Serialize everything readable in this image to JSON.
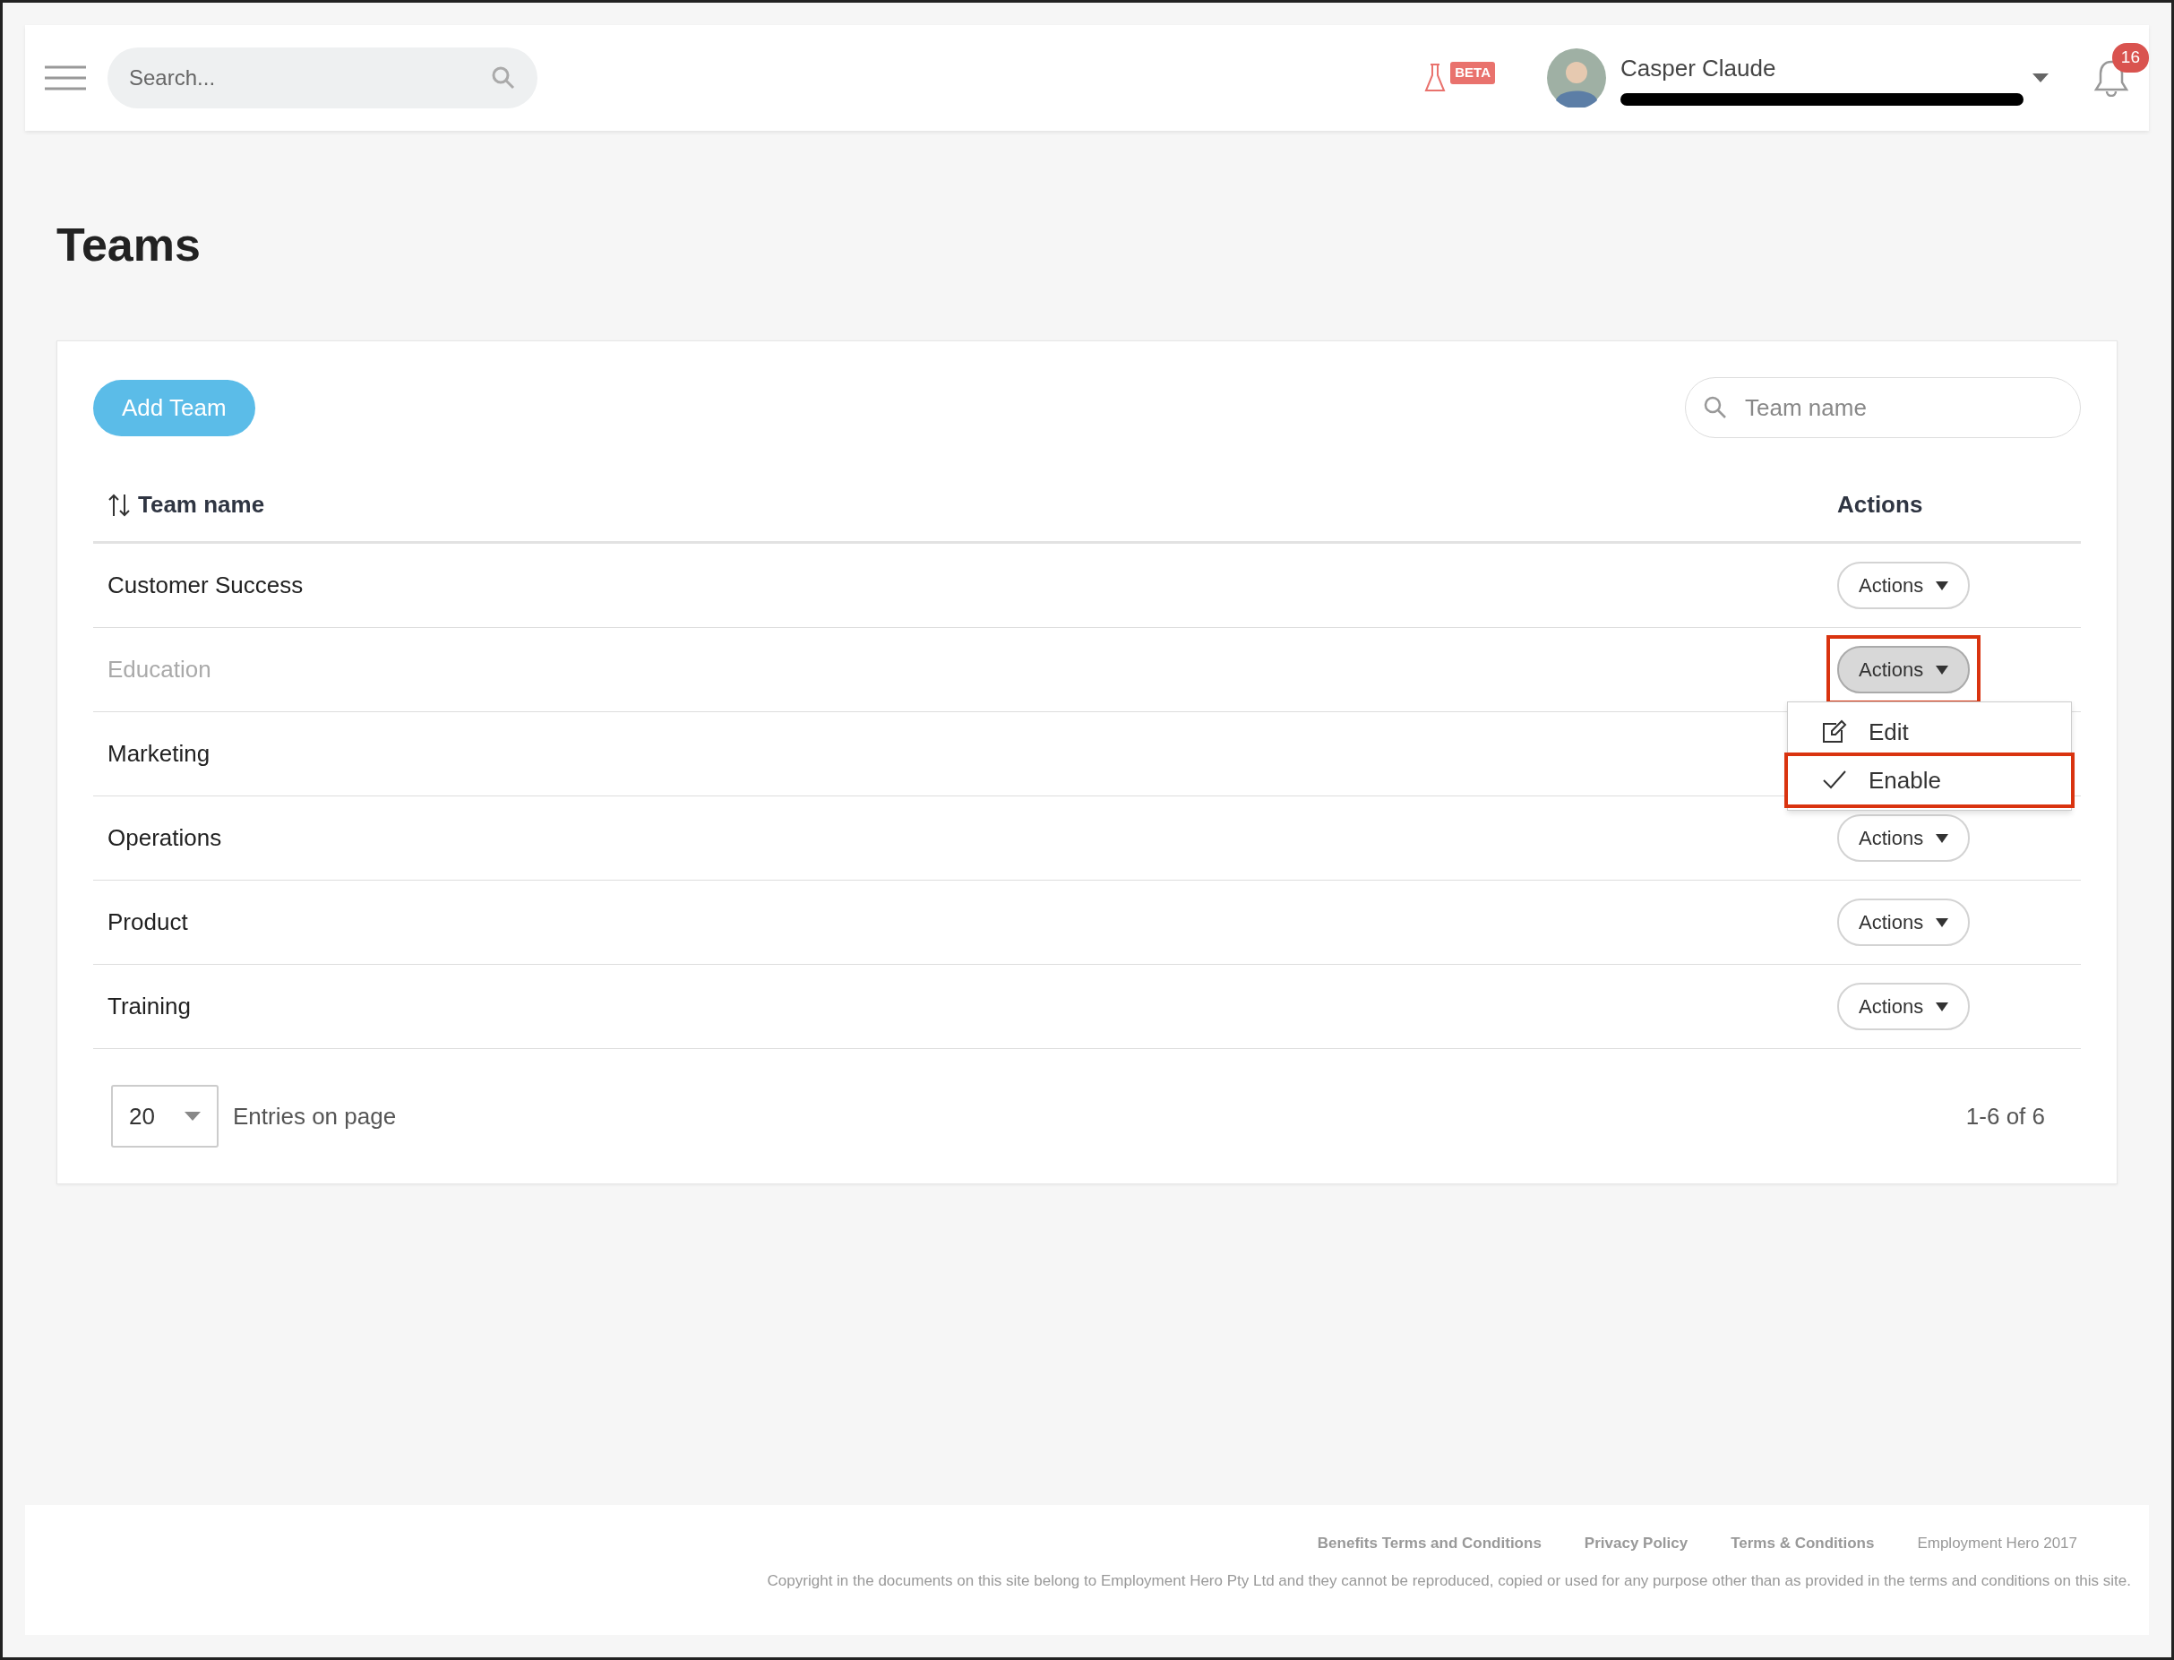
{
  "header": {
    "search": {
      "placeholder": "Search..."
    },
    "beta_badge": "BETA",
    "user": {
      "name": "Casper Claude",
      "email_redacted": true
    },
    "notifications": "16"
  },
  "page_title": "Teams",
  "toolbar": {
    "add_button": "Add Team",
    "filter": {
      "placeholder": "Team name"
    }
  },
  "table": {
    "columns": [
      {
        "label": "Team name",
        "sortable": true
      },
      {
        "label": "Actions",
        "sortable": false
      }
    ],
    "rows": [
      {
        "name": "Customer Success",
        "disabled": false,
        "action": {
          "label": "Actions",
          "pressed": false,
          "highlighted": false
        }
      },
      {
        "name": "Education",
        "disabled": true,
        "action": {
          "label": "Actions",
          "pressed": true,
          "highlighted": true
        },
        "menu": [
          {
            "kind": "edit",
            "label": "Edit",
            "highlighted": false
          },
          {
            "kind": "check",
            "label": "Enable",
            "highlighted": true
          }
        ]
      },
      {
        "name": "Marketing",
        "disabled": false
      },
      {
        "name": "Operations",
        "disabled": false,
        "action": {
          "label": "Actions",
          "pressed": false,
          "highlighted": false
        }
      },
      {
        "name": "Product",
        "disabled": false,
        "action": {
          "label": "Actions",
          "pressed": false,
          "highlighted": false
        }
      },
      {
        "name": "Training",
        "disabled": false,
        "action": {
          "label": "Actions",
          "pressed": false,
          "highlighted": false
        }
      }
    ]
  },
  "pagination": {
    "page_size": "20",
    "label": "Entries on page",
    "range": "1-6 of 6"
  },
  "footer": {
    "links": [
      "Benefits Terms and Conditions",
      "Privacy Policy",
      "Terms & Conditions"
    ],
    "brand": "Employment Hero 2017",
    "copyright": "Copyright in the documents on this site belong to Employment Hero Pty Ltd and they cannot be reproduced, copied or used for any purpose other than as provided in the terms and conditions on this site."
  }
}
